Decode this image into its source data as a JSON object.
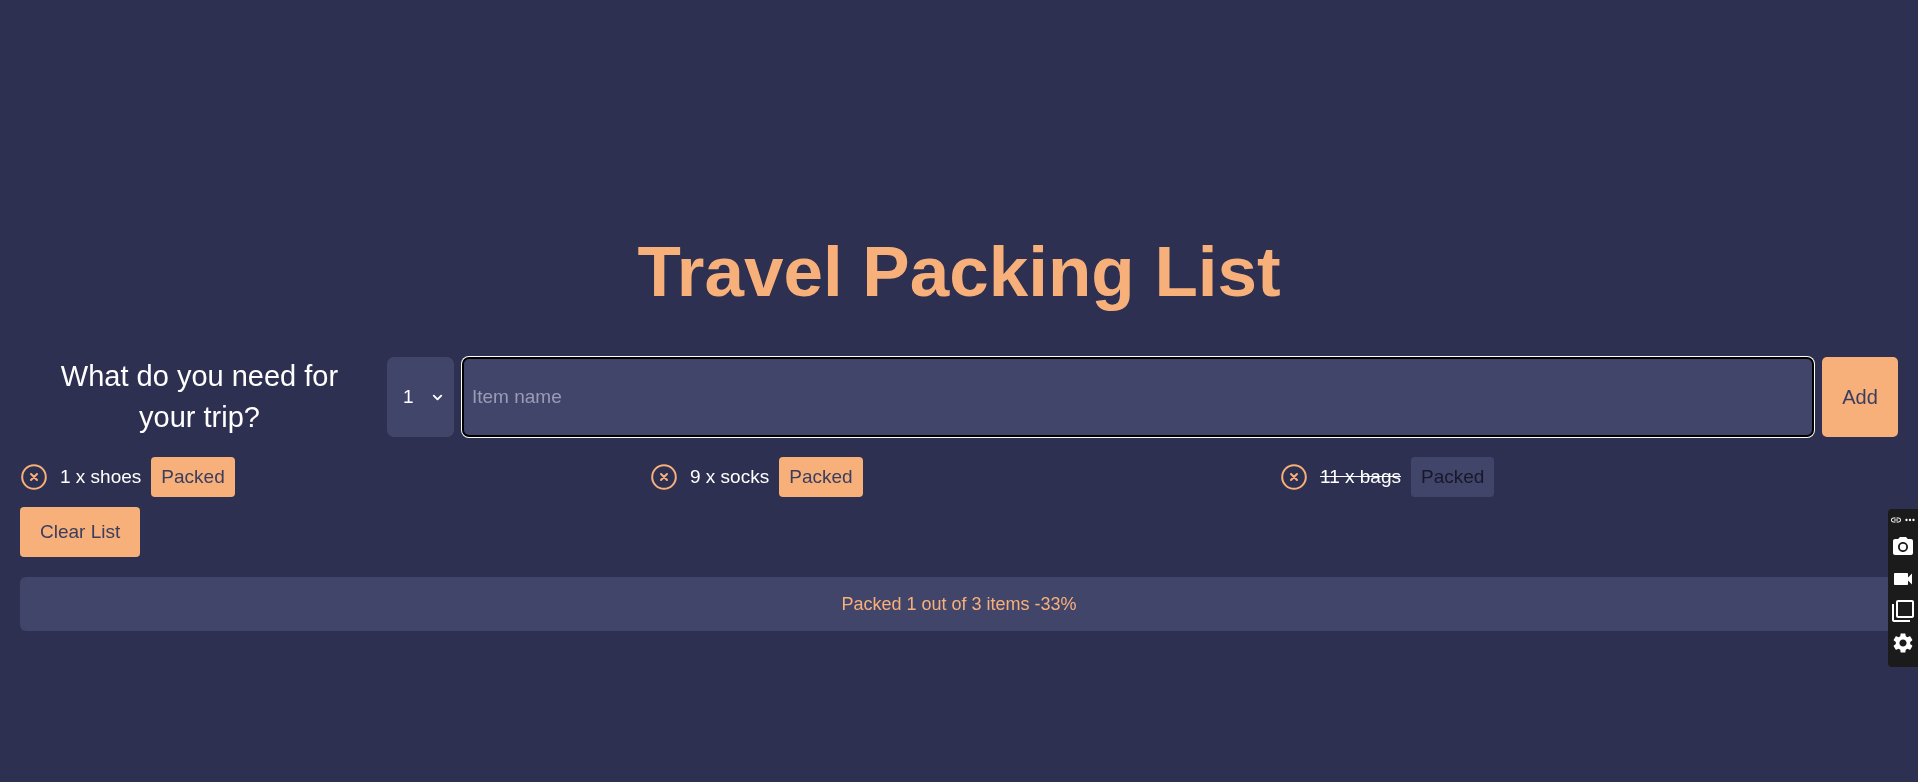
{
  "title": "Travel Packing List",
  "form": {
    "question": "What do you need for your trip?",
    "quantity": "1",
    "item_field": {
      "placeholder": "Item name"
    },
    "add_button": "Add"
  },
  "items": [
    {
      "text": "1 x shoes",
      "packed": false,
      "button": "Packed"
    },
    {
      "text": "9 x socks",
      "packed": false,
      "button": "Packed"
    },
    {
      "text": "11 x bags",
      "packed": true,
      "button": "Packed"
    }
  ],
  "clear_button": "Clear List",
  "stats": "Packed 1 out of 3 items -33%"
}
